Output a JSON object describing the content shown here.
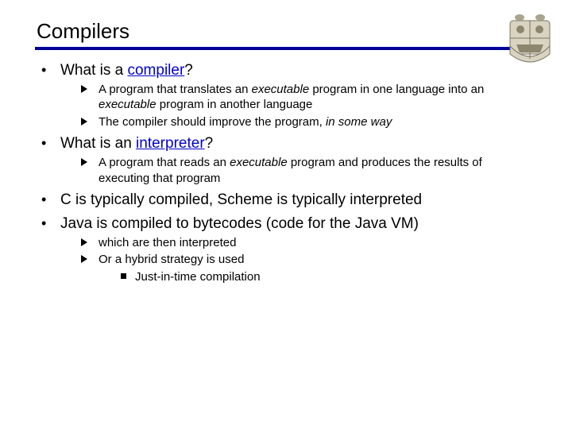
{
  "title": "Compilers",
  "bullets": {
    "b1": {
      "prefix": "What is a ",
      "link": "compiler",
      "suffix": "?",
      "sub": [
        {
          "t1": "A program that translates an ",
          "e1": "executable",
          "t2": " program in one language into an ",
          "e2": "executable",
          "t3": " program in another language"
        },
        {
          "t1": "The compiler should improve the program, ",
          "e1": "in some way",
          "t2": ""
        }
      ]
    },
    "b2": {
      "prefix": "What is an ",
      "link": "interpreter",
      "suffix": "?",
      "sub": [
        {
          "t1": "A program that reads an ",
          "e1": "executable",
          "t2": " program and produces the results of executing that program"
        }
      ]
    },
    "b3": {
      "text": "C is typically compiled, Scheme is typically interpreted"
    },
    "b4": {
      "text": "Java is compiled to bytecodes (code for the Java VM)",
      "sub": [
        {
          "text": "which are then interpreted"
        },
        {
          "text": "Or a hybrid strategy is used",
          "sub3": [
            {
              "text": "Just-in-time compilation"
            }
          ]
        }
      ]
    }
  }
}
